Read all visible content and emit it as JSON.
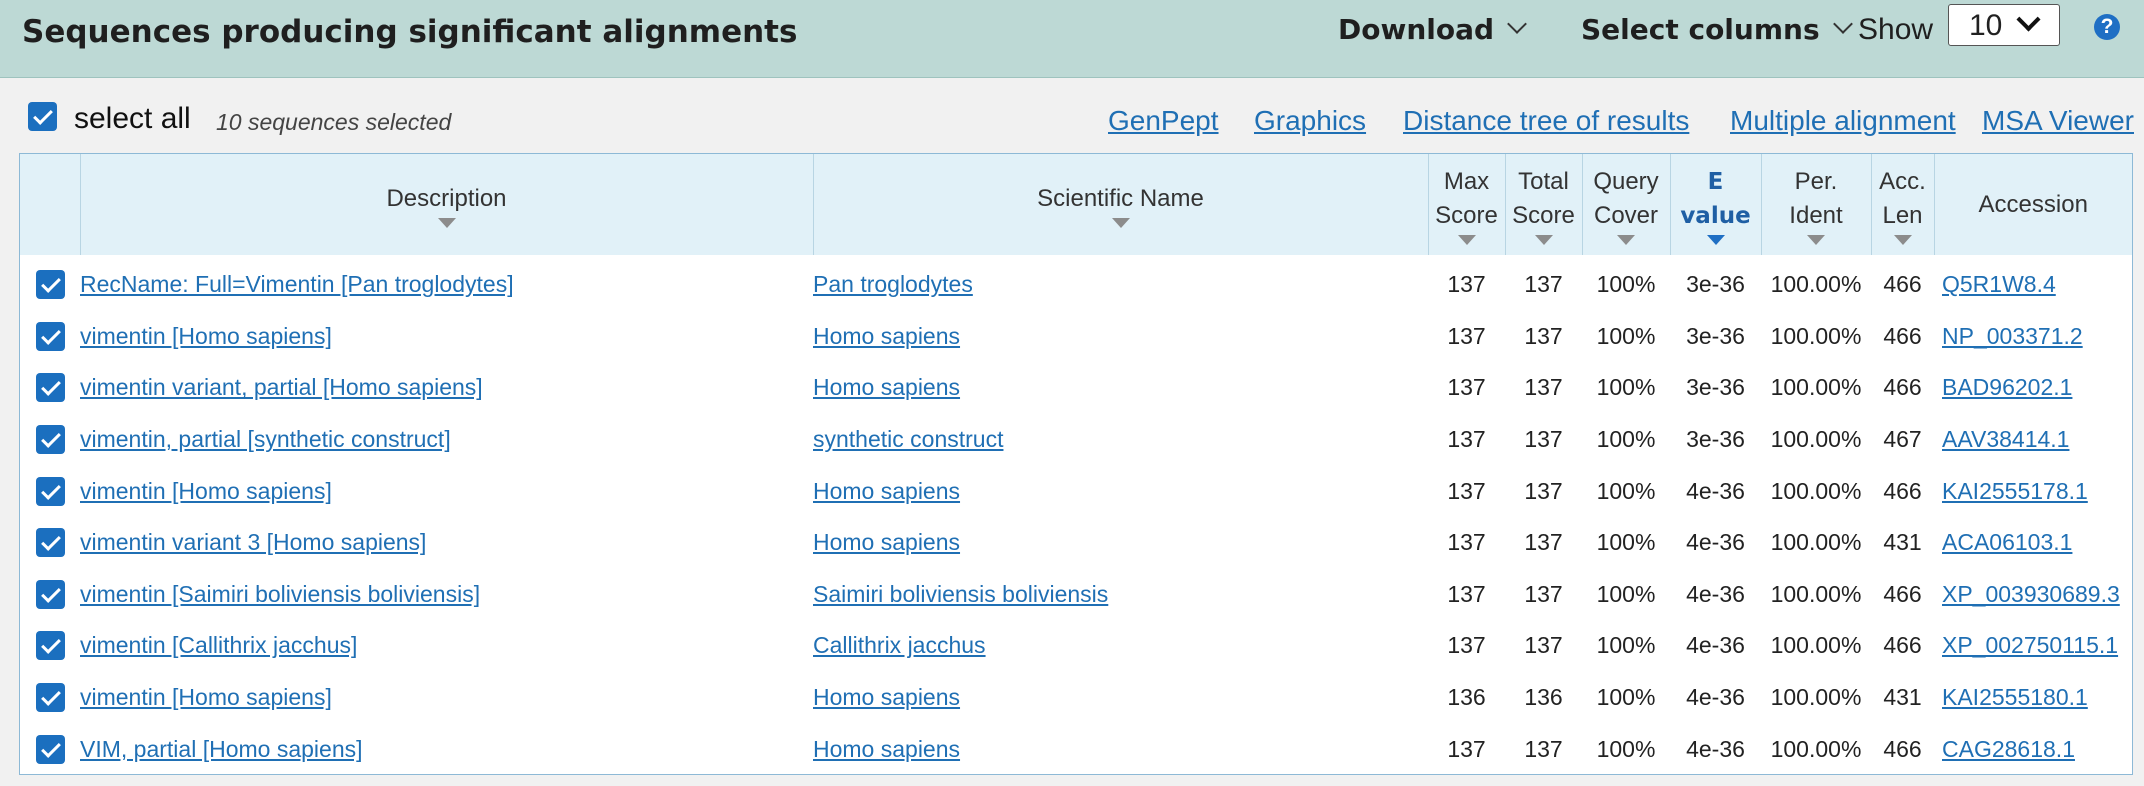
{
  "header": {
    "title": "Sequences producing significant alignments",
    "download_label": "Download",
    "select_columns_label": "Select columns",
    "show_label": "Show",
    "show_value": "10",
    "help_glyph": "?"
  },
  "toolbar": {
    "select_all_label": "select all",
    "selected_count": "10 sequences selected",
    "links": [
      "GenPept",
      "Graphics",
      "Distance tree of results",
      "Multiple alignment",
      "MSA Viewer"
    ]
  },
  "columns": {
    "description": "Description",
    "scientific_name": "Scientific Name",
    "max_score_1": "Max",
    "max_score_2": "Score",
    "total_score_1": "Total",
    "total_score_2": "Score",
    "query_cover_1": "Query",
    "query_cover_2": "Cover",
    "evalue_1": "E",
    "evalue_2": "value",
    "per_ident_1": "Per.",
    "per_ident_2": "Ident",
    "acc_len_1": "Acc.",
    "acc_len_2": "Len",
    "accession": "Accession"
  },
  "rows": [
    {
      "description": "RecName: Full=Vimentin [Pan troglodytes]",
      "scientific_name": "Pan troglodytes",
      "max_score": "137",
      "total_score": "137",
      "query_cover": "100%",
      "evalue": "3e-36",
      "per_ident": "100.00%",
      "acc_len": "466",
      "accession": "Q5R1W8.4"
    },
    {
      "description": "vimentin [Homo sapiens]",
      "scientific_name": "Homo sapiens",
      "max_score": "137",
      "total_score": "137",
      "query_cover": "100%",
      "evalue": "3e-36",
      "per_ident": "100.00%",
      "acc_len": "466",
      "accession": "NP_003371.2"
    },
    {
      "description": "vimentin variant, partial [Homo sapiens]",
      "scientific_name": "Homo sapiens",
      "max_score": "137",
      "total_score": "137",
      "query_cover": "100%",
      "evalue": "3e-36",
      "per_ident": "100.00%",
      "acc_len": "466",
      "accession": "BAD96202.1"
    },
    {
      "description": "vimentin, partial [synthetic construct]",
      "scientific_name": "synthetic construct",
      "max_score": "137",
      "total_score": "137",
      "query_cover": "100%",
      "evalue": "3e-36",
      "per_ident": "100.00%",
      "acc_len": "467",
      "accession": "AAV38414.1"
    },
    {
      "description": "vimentin [Homo sapiens]",
      "scientific_name": "Homo sapiens",
      "max_score": "137",
      "total_score": "137",
      "query_cover": "100%",
      "evalue": "4e-36",
      "per_ident": "100.00%",
      "acc_len": "466",
      "accession": "KAI2555178.1"
    },
    {
      "description": "vimentin variant 3 [Homo sapiens]",
      "scientific_name": "Homo sapiens",
      "max_score": "137",
      "total_score": "137",
      "query_cover": "100%",
      "evalue": "4e-36",
      "per_ident": "100.00%",
      "acc_len": "431",
      "accession": "ACA06103.1"
    },
    {
      "description": "vimentin [Saimiri boliviensis boliviensis]",
      "scientific_name": "Saimiri boliviensis boliviensis",
      "max_score": "137",
      "total_score": "137",
      "query_cover": "100%",
      "evalue": "4e-36",
      "per_ident": "100.00%",
      "acc_len": "466",
      "accession": "XP_003930689.3"
    },
    {
      "description": "vimentin [Callithrix jacchus]",
      "scientific_name": "Callithrix jacchus",
      "max_score": "137",
      "total_score": "137",
      "query_cover": "100%",
      "evalue": "4e-36",
      "per_ident": "100.00%",
      "acc_len": "466",
      "accession": "XP_002750115.1"
    },
    {
      "description": "vimentin [Homo sapiens]",
      "scientific_name": "Homo sapiens",
      "max_score": "136",
      "total_score": "136",
      "query_cover": "100%",
      "evalue": "4e-36",
      "per_ident": "100.00%",
      "acc_len": "431",
      "accession": "KAI2555180.1"
    },
    {
      "description": "VIM, partial [Homo sapiens]",
      "scientific_name": "Homo sapiens",
      "max_score": "137",
      "total_score": "137",
      "query_cover": "100%",
      "evalue": "4e-36",
      "per_ident": "100.00%",
      "acc_len": "466",
      "accession": "CAG28618.1"
    }
  ],
  "colors": {
    "header_bg": "#bdd9d5",
    "link": "#1f6fb4",
    "checkbox": "#1b6fbf",
    "table_header_bg": "#e1f1f8"
  }
}
